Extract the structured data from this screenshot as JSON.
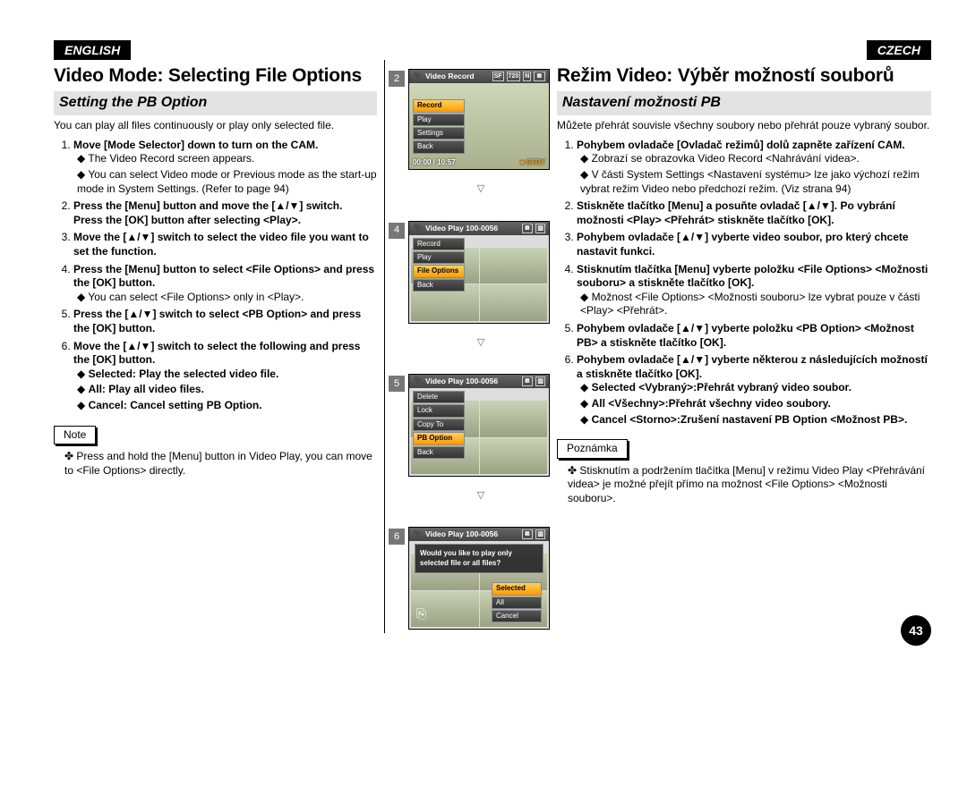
{
  "lang": {
    "en": "ENGLISH",
    "cz": "CZECH"
  },
  "en": {
    "title": "Video Mode: Selecting File Options",
    "section": "Setting the PB Option",
    "intro": "You can play all files continuously or play only selected file.",
    "steps": {
      "s1": "Move [Mode Selector] down to turn on the CAM.",
      "s1a": "The Video Record screen appears.",
      "s1b": "You can select Video mode or Previous mode as the start-up mode in System Settings. (Refer to page 94)",
      "s2a": "Press the [Menu] button and move the [▲/▼] switch.",
      "s2b": "Press the [OK] button after selecting <Play>.",
      "s3": "Move the [▲/▼] switch to select the video file you want to set the function.",
      "s4": "Press the [Menu] button to select <File Options> and press the [OK] button.",
      "s4a": "You can select <File Options> only in <Play>.",
      "s5": "Press the [▲/▼] switch to select <PB Option> and press the [OK] button.",
      "s6": "Move the [▲/▼] switch to select the following and press the [OK] button.",
      "s6a": "Selected: Play the selected video file.",
      "s6b": "All: Play all video files.",
      "s6c": "Cancel: Cancel setting PB Option."
    },
    "noteLabel": "Note",
    "noteText": "Press and hold the [Menu] button in Video Play, you can move to <File Options> directly."
  },
  "cz": {
    "title": "Režim Video: Výběr možností souborů",
    "section": "Nastavení možnosti PB",
    "intro": "Můžete přehrát souvisle všechny soubory nebo přehrát pouze vybraný soubor.",
    "steps": {
      "s1": "Pohybem ovladače [Ovladač režimů] dolů zapněte zařízení CAM.",
      "s1a": "Zobrazí se obrazovka Video Record <Nahrávání videa>.",
      "s1b": "V části System Settings <Nastavení systému> lze jako výchozí režim vybrat režim Video nebo předchozí režim. (Viz strana 94)",
      "s2": "Stiskněte tlačítko [Menu] a posuňte ovladač [▲/▼]. Po vybrání možnosti <Play> <Přehrát> stiskněte tlačítko [OK].",
      "s3": "Pohybem ovladače [▲/▼] vyberte video soubor, pro který chcete nastavit funkci.",
      "s4": "Stisknutím tlačítka [Menu] vyberte položku <File Options> <Možnosti souboru> a stiskněte tlačítko [OK].",
      "s4a": "Možnost <File Options> <Možnosti souboru> lze vybrat pouze v části <Play> <Přehrát>.",
      "s5": "Pohybem ovladače [▲/▼] vyberte položku <PB Option> <Možnost PB> a stiskněte tlačítko [OK].",
      "s6": "Pohybem ovladače [▲/▼] vyberte některou z následujících možností a stiskněte tlačítko [OK].",
      "s6a": "Selected <Vybraný>:Přehrát vybraný video soubor.",
      "s6b": "All <Všechny>:Přehrát všechny video soubory.",
      "s6c": "Cancel <Storno>:Zrušení nastavení PB Option <Možnost PB>."
    },
    "noteLabel": "Poznámka",
    "noteText": "Stisknutím a podržením tlačítka [Menu] v režimu Video Play <Přehrávání videa> je možné přejít přímo na možnost <File Options> <Možnosti souboru>."
  },
  "screens": {
    "s2": {
      "title": "Video Record",
      "badges": [
        "SF",
        "720",
        "N"
      ],
      "menu": [
        "Record",
        "Play",
        "Settings",
        "Back"
      ],
      "selected": "Record",
      "time": "00:00 / 10:57",
      "status": "STBY"
    },
    "s4": {
      "title": "Video Play  100-0056",
      "menu": [
        "Record",
        "Play",
        "File Options",
        "Back"
      ],
      "selected": "File Options"
    },
    "s5": {
      "title": "Video Play  100-0056",
      "menu": [
        "Delete",
        "Lock",
        "Copy To",
        "PB Option",
        "Back"
      ],
      "selected": "PB Option"
    },
    "s6": {
      "title": "Video Play  100-0056",
      "dialog": "Would you like to play only selected file or all files?",
      "buttons": [
        "Selected",
        "All",
        "Cancel"
      ],
      "selected": "Selected"
    }
  },
  "pageNumber": "43"
}
